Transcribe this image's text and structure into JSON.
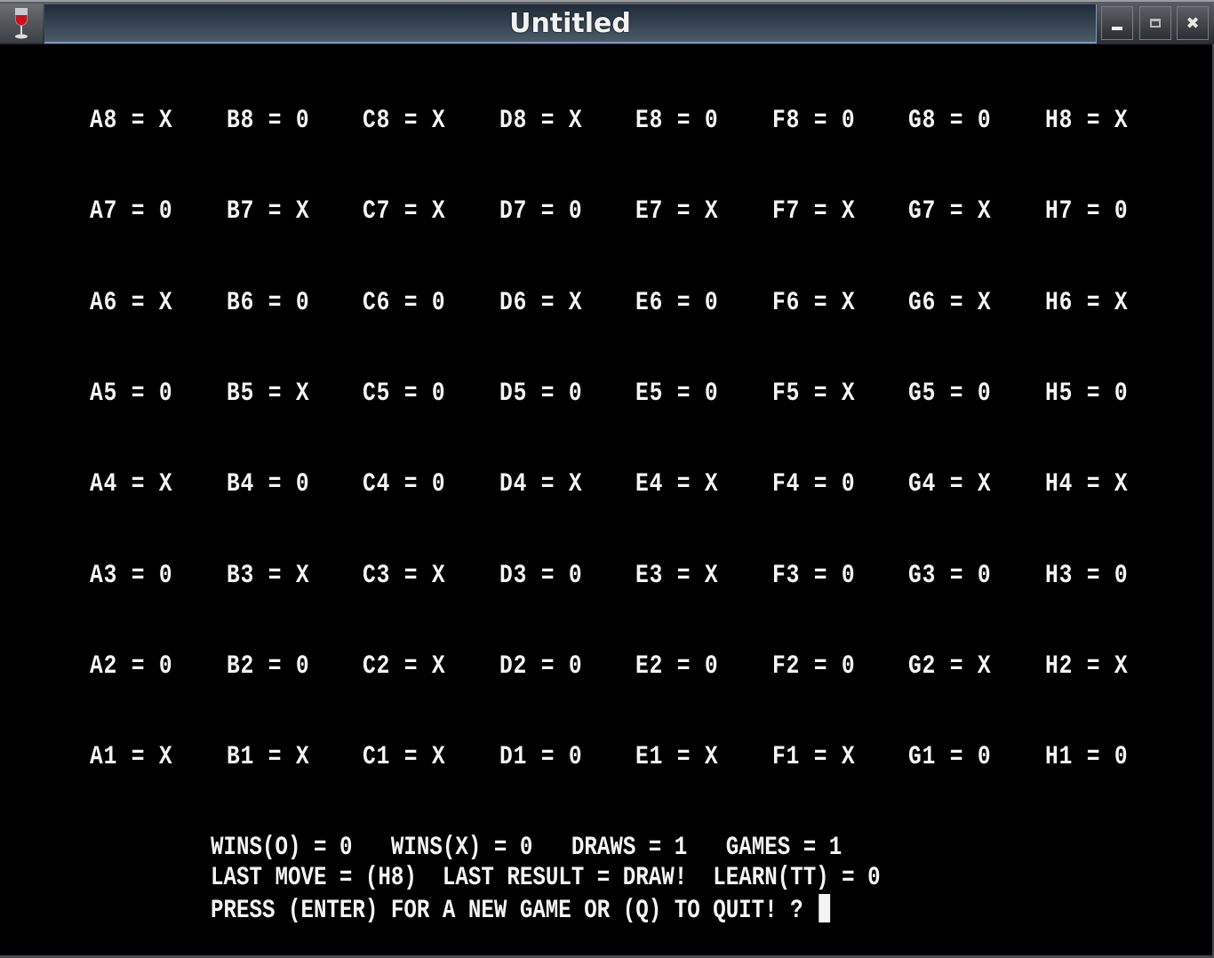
{
  "window": {
    "title": "Untitled",
    "app_icon": "wine-glass-icon",
    "buttons": [
      {
        "name": "minimize",
        "icon": "minimize-icon",
        "glyph": "‒"
      },
      {
        "name": "maximize",
        "icon": "maximize-icon",
        "glyph": "□"
      },
      {
        "name": "close",
        "icon": "close-icon",
        "glyph": "✖"
      }
    ]
  },
  "board": {
    "columns": [
      "A",
      "B",
      "C",
      "D",
      "E",
      "F",
      "G",
      "H"
    ],
    "rows": [
      {
        "rank": "8",
        "cells": [
          {
            "label": "A8",
            "value": "X"
          },
          {
            "label": "B8",
            "value": "0"
          },
          {
            "label": "C8",
            "value": "X"
          },
          {
            "label": "D8",
            "value": "X"
          },
          {
            "label": "E8",
            "value": "0"
          },
          {
            "label": "F8",
            "value": "0"
          },
          {
            "label": "G8",
            "value": "0"
          },
          {
            "label": "H8",
            "value": "X"
          }
        ]
      },
      {
        "rank": "7",
        "cells": [
          {
            "label": "A7",
            "value": "0"
          },
          {
            "label": "B7",
            "value": "X"
          },
          {
            "label": "C7",
            "value": "X"
          },
          {
            "label": "D7",
            "value": "0"
          },
          {
            "label": "E7",
            "value": "X"
          },
          {
            "label": "F7",
            "value": "X"
          },
          {
            "label": "G7",
            "value": "X"
          },
          {
            "label": "H7",
            "value": "0"
          }
        ]
      },
      {
        "rank": "6",
        "cells": [
          {
            "label": "A6",
            "value": "X"
          },
          {
            "label": "B6",
            "value": "0"
          },
          {
            "label": "C6",
            "value": "0"
          },
          {
            "label": "D6",
            "value": "X"
          },
          {
            "label": "E6",
            "value": "0"
          },
          {
            "label": "F6",
            "value": "X"
          },
          {
            "label": "G6",
            "value": "X"
          },
          {
            "label": "H6",
            "value": "X"
          }
        ]
      },
      {
        "rank": "5",
        "cells": [
          {
            "label": "A5",
            "value": "0"
          },
          {
            "label": "B5",
            "value": "X"
          },
          {
            "label": "C5",
            "value": "0"
          },
          {
            "label": "D5",
            "value": "0"
          },
          {
            "label": "E5",
            "value": "0"
          },
          {
            "label": "F5",
            "value": "X"
          },
          {
            "label": "G5",
            "value": "0"
          },
          {
            "label": "H5",
            "value": "0"
          }
        ]
      },
      {
        "rank": "4",
        "cells": [
          {
            "label": "A4",
            "value": "X"
          },
          {
            "label": "B4",
            "value": "0"
          },
          {
            "label": "C4",
            "value": "0"
          },
          {
            "label": "D4",
            "value": "X"
          },
          {
            "label": "E4",
            "value": "X"
          },
          {
            "label": "F4",
            "value": "0"
          },
          {
            "label": "G4",
            "value": "X"
          },
          {
            "label": "H4",
            "value": "X"
          }
        ]
      },
      {
        "rank": "3",
        "cells": [
          {
            "label": "A3",
            "value": "0"
          },
          {
            "label": "B3",
            "value": "X"
          },
          {
            "label": "C3",
            "value": "X"
          },
          {
            "label": "D3",
            "value": "0"
          },
          {
            "label": "E3",
            "value": "X"
          },
          {
            "label": "F3",
            "value": "0"
          },
          {
            "label": "G3",
            "value": "0"
          },
          {
            "label": "H3",
            "value": "0"
          }
        ]
      },
      {
        "rank": "2",
        "cells": [
          {
            "label": "A2",
            "value": "0"
          },
          {
            "label": "B2",
            "value": "0"
          },
          {
            "label": "C2",
            "value": "X"
          },
          {
            "label": "D2",
            "value": "0"
          },
          {
            "label": "E2",
            "value": "0"
          },
          {
            "label": "F2",
            "value": "0"
          },
          {
            "label": "G2",
            "value": "X"
          },
          {
            "label": "H2",
            "value": "X"
          }
        ]
      },
      {
        "rank": "1",
        "cells": [
          {
            "label": "A1",
            "value": "X"
          },
          {
            "label": "B1",
            "value": "X"
          },
          {
            "label": "C1",
            "value": "X"
          },
          {
            "label": "D1",
            "value": "0"
          },
          {
            "label": "E1",
            "value": "X"
          },
          {
            "label": "F1",
            "value": "X"
          },
          {
            "label": "G1",
            "value": "0"
          },
          {
            "label": "H1",
            "value": "0"
          }
        ]
      }
    ]
  },
  "stats": {
    "wins_o_label": "WINS(O)",
    "wins_o": "0",
    "wins_x_label": "WINS(X)",
    "wins_x": "0",
    "draws_label": "DRAWS",
    "draws": "1",
    "games_label": "GAMES",
    "games": "1"
  },
  "last": {
    "move_label": "LAST MOVE",
    "move": "(H8)",
    "result_label": "LAST RESULT",
    "result": "DRAW!",
    "learn_label": "LEARN(TT)",
    "learn": "0"
  },
  "prompt": {
    "text": "PRESS (ENTER) FOR A NEW GAME OR (Q) TO QUIT! ?"
  }
}
